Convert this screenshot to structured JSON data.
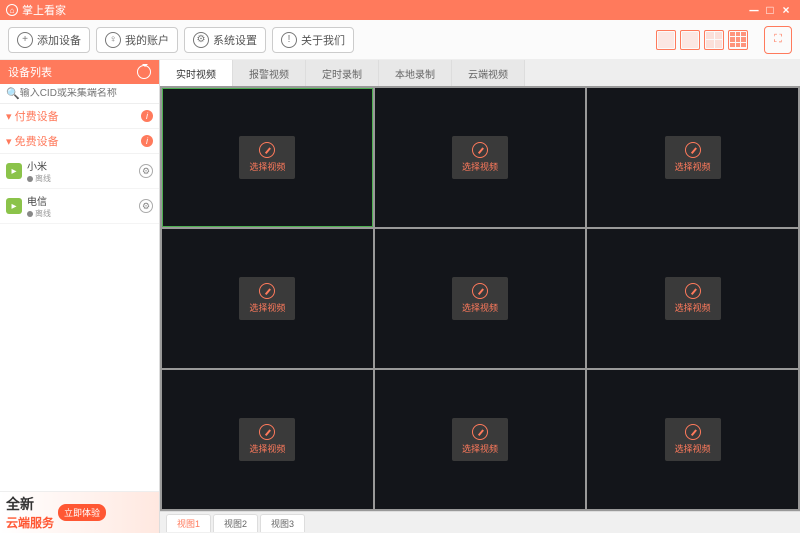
{
  "title": "掌上看家",
  "toolbar": {
    "add_device": "添加设备",
    "my_account": "我的账户",
    "system_settings": "系统设置",
    "about_us": "关于我们"
  },
  "sidebar": {
    "header": "设备列表",
    "search_placeholder": "输入CID或采集端名称",
    "cat_paid": "▾ 付费设备",
    "cat_free": "▾ 免费设备",
    "devices": [
      {
        "name": "小米",
        "status": "离线"
      },
      {
        "name": "电信",
        "status": "离线"
      }
    ]
  },
  "promo": {
    "big": "全新",
    "cloud": "云端服务",
    "btn": "立即体验"
  },
  "tabs": [
    "实时视频",
    "报警视频",
    "定时录制",
    "本地录制",
    "云端视频"
  ],
  "cell_label": "选择视频",
  "bottom_tabs": [
    "视图1",
    "视图2",
    "视图3"
  ]
}
